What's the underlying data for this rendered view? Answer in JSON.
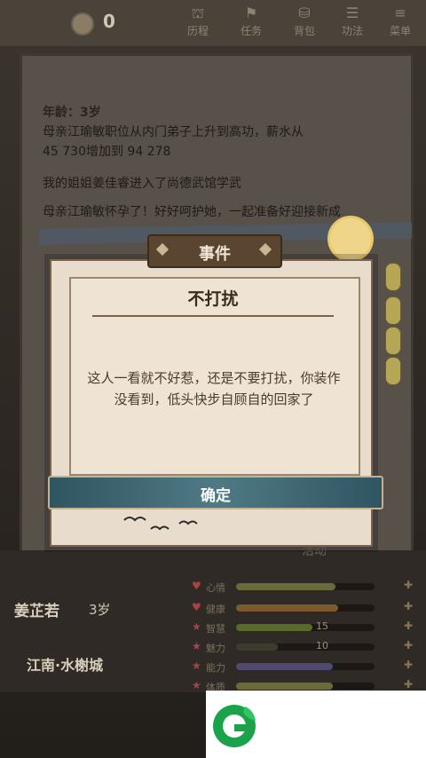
{
  "topbar": {
    "coin_value": "0",
    "tabs": [
      {
        "label": "历程",
        "icon": "lantern-icon"
      },
      {
        "label": "任务",
        "icon": "scroll-icon"
      },
      {
        "label": "背包",
        "icon": "bag-icon"
      },
      {
        "label": "功法",
        "icon": "book-icon"
      },
      {
        "label": "菜单",
        "icon": "menu-icon"
      }
    ]
  },
  "journal": {
    "age_line": "年龄：3岁",
    "line1": "母亲江瑜敏职位从内门弟子上升到高功，薪水从",
    "line2": "45  730增加到  94  278",
    "line3": "我的姐姐姜佳睿进入了尚德武馆学武",
    "line4": "母亲江瑜敏怀孕了！好好呵护她，一起准备好迎接新成"
  },
  "modal": {
    "header": "事件",
    "title": "不打扰",
    "body": "这人一看就不好惹，还是不要打扰，你装作没看到，低头快步自顾自的回家了",
    "confirm_label": "确定"
  },
  "character": {
    "name": "姜芷若",
    "age": "3岁",
    "location": "江南·水榭城",
    "activity_label": "活动"
  },
  "stats": [
    {
      "label": "心情",
      "value": "",
      "fill": 0.72,
      "color": "#6b6a3a"
    },
    {
      "label": "健康",
      "value": "",
      "fill": 0.74,
      "color": "#7d5a2a"
    },
    {
      "label": "智慧",
      "value": "15",
      "fill": 0.55,
      "color": "#5a6a2a"
    },
    {
      "label": "魅力",
      "value": "10",
      "fill": 0.3,
      "color": "#3b3b2f"
    },
    {
      "label": "能力",
      "value": "",
      "fill": 0.7,
      "color": "#4d4b6f"
    },
    {
      "label": "体质",
      "value": "",
      "fill": 0.7,
      "color": "#6b6a3a"
    }
  ],
  "colors": {
    "header_bg": "#5a4630",
    "button_bg": "#3f6a75",
    "paper": "#e8dccc"
  }
}
